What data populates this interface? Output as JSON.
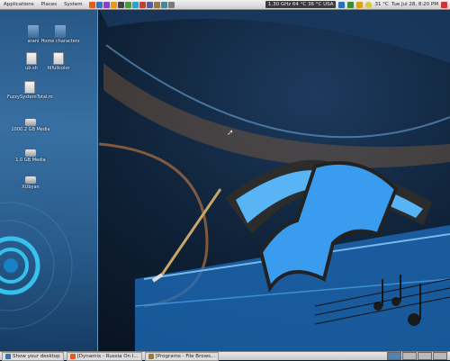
{
  "top_panel": {
    "menus": [
      "Applications",
      "Places",
      "System"
    ],
    "cpu_status": "1.30 GHz 64 °C 36 °C USA",
    "weather": "31 °C",
    "clock": "Tue Jul 28, 8:20 PM"
  },
  "desktop_icons": [
    {
      "label": "arani",
      "kind": "folder"
    },
    {
      "label": "Home characters",
      "kind": "folder"
    },
    {
      "label": "ub.sh",
      "kind": "file"
    },
    {
      "label": "fdfullcolor",
      "kind": "file"
    },
    {
      "label": "FuzzySystemTotal.m",
      "kind": "file"
    },
    {
      "label": "1000.2 GB Media",
      "kind": "drive"
    },
    {
      "label": "1.0 GB Media",
      "kind": "drive"
    },
    {
      "label": "XUbyan",
      "kind": "drive"
    }
  ],
  "taskbar": {
    "items": [
      {
        "label": "Show your desktop"
      },
      {
        "label": "[Dynamix - Russia On I..."
      },
      {
        "label": "[Programs - File Brows..."
      }
    ]
  },
  "colors": {
    "accent_blue": "#2f8fe0",
    "panel_gray": "#d6d6d6",
    "wall_dark": "#0b1a2c"
  }
}
